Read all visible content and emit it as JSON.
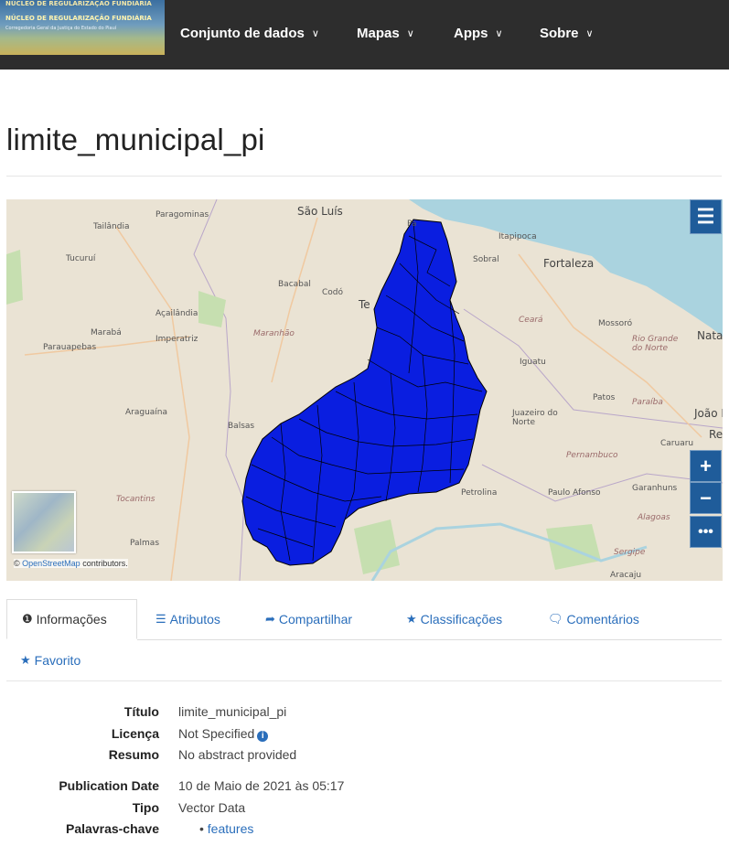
{
  "header": {
    "logo_lines": [
      "NÚCLEO DE REGULARIZAÇÃO FUNDIÁRIA"
    ],
    "nav": [
      {
        "label": "Conjunto de dados"
      },
      {
        "label": "Mapas"
      },
      {
        "label": "Apps"
      },
      {
        "label": "Sobre"
      }
    ]
  },
  "page": {
    "title": "limite_municipal_pi"
  },
  "map": {
    "attribution_link": "OpenStreetMap",
    "attribution_suffix": " contributors.",
    "attribution_prefix": "© ",
    "layer_color": "#0a1ee0",
    "labels": [
      "São Luís",
      "Paragominas",
      "Tailândia",
      "Tucuruí",
      "Bacabal",
      "Codó",
      "Açailândia",
      "Marabá",
      "Imperatriz",
      "Parauapebas",
      "Maranhão",
      "Araguaína",
      "Balsas",
      "Tocantins",
      "Palmas",
      "Itapipoca",
      "Sobral",
      "Fortaleza",
      "Ceará",
      "Mossoró",
      "Iguatu",
      "Juazeiro do Norte",
      "Patos",
      "Paraíba",
      "João P",
      "Rio Grande do Norte",
      "Caruaru",
      "Pernambuco",
      "Petrolina",
      "Paulo Afonso",
      "Garanhuns",
      "Alagoas",
      "Sergipe",
      "Natal",
      "Re",
      "Te",
      "Pa",
      "Aracaju"
    ]
  },
  "tabs": [
    {
      "label": "Informações",
      "icon": "info-circle-icon"
    },
    {
      "label": "Atributos",
      "icon": "list-icon"
    },
    {
      "label": "Compartilhar",
      "icon": "share-icon"
    },
    {
      "label": "Classificações",
      "icon": "star-icon"
    },
    {
      "label": "Comentários",
      "icon": "comment-icon"
    },
    {
      "label": "Favorito",
      "icon": "star-icon"
    }
  ],
  "info": {
    "titulo_label": "Título",
    "titulo_value": "limite_municipal_pi",
    "licenca_label": "Licença",
    "licenca_value": "Not Specified",
    "resumo_label": "Resumo",
    "resumo_value": "No abstract provided",
    "pubdate_label": "Publication Date",
    "pubdate_value": "10 de Maio de 2021 às 05:17",
    "tipo_label": "Tipo",
    "tipo_value": "Vector Data",
    "keywords_label": "Palavras-chave",
    "keywords": [
      "features"
    ]
  }
}
